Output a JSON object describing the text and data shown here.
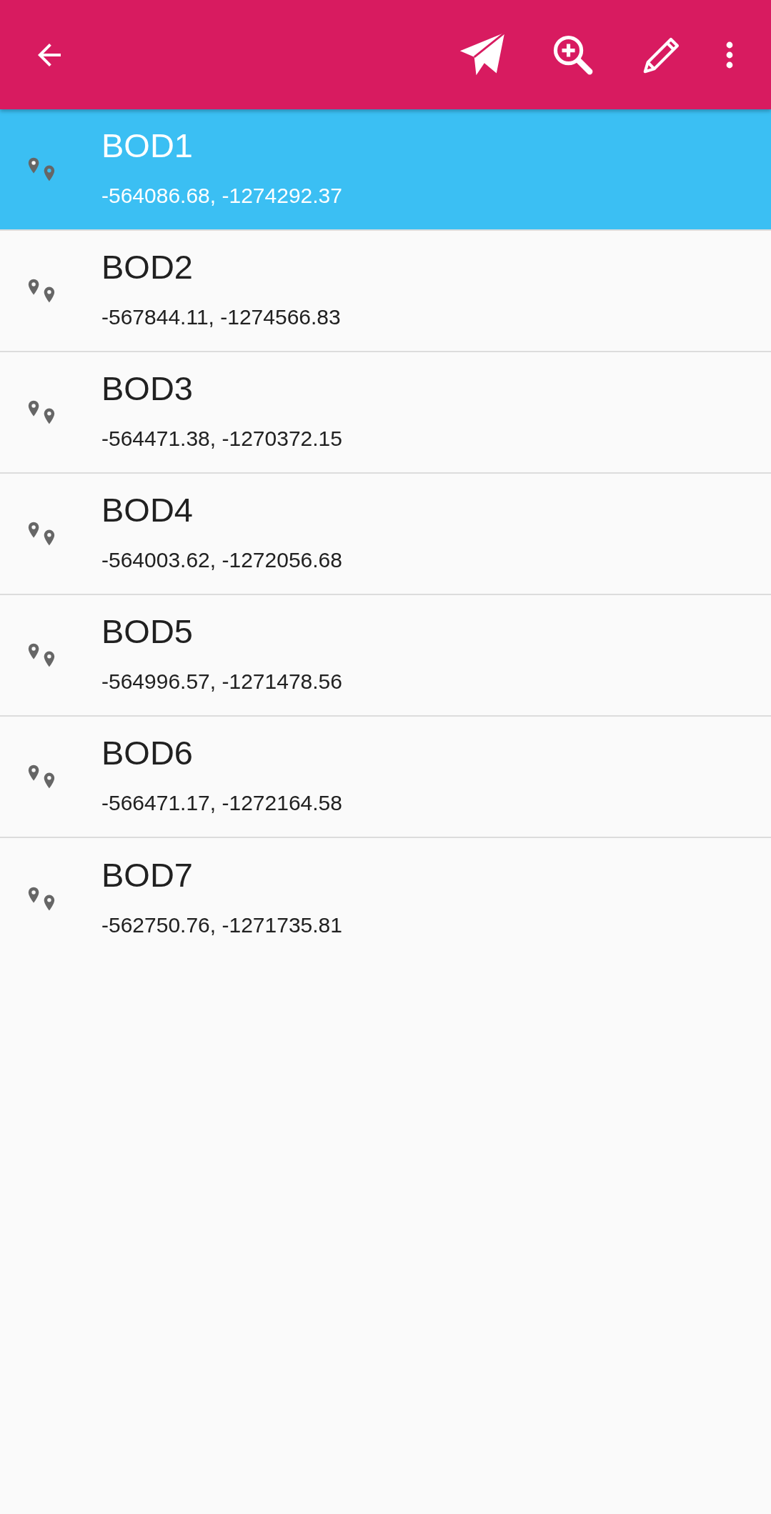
{
  "points": [
    {
      "name": "BOD1",
      "coords": "-564086.68, -1274292.37",
      "selected": true
    },
    {
      "name": "BOD2",
      "coords": "-567844.11, -1274566.83",
      "selected": false
    },
    {
      "name": "BOD3",
      "coords": "-564471.38, -1270372.15",
      "selected": false
    },
    {
      "name": "BOD4",
      "coords": "-564003.62, -1272056.68",
      "selected": false
    },
    {
      "name": "BOD5",
      "coords": "-564996.57, -1271478.56",
      "selected": false
    },
    {
      "name": "BOD6",
      "coords": "-566471.17, -1272164.58",
      "selected": false
    },
    {
      "name": "BOD7",
      "coords": "-562750.76, -1271735.81",
      "selected": false
    }
  ]
}
